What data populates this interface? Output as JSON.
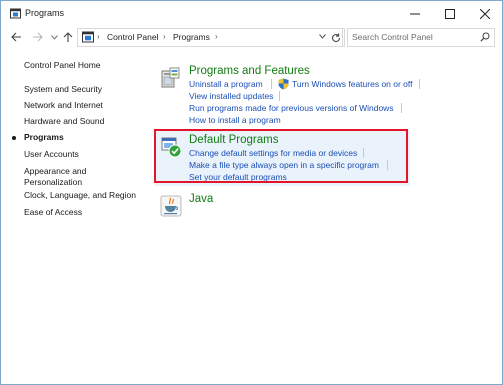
{
  "window": {
    "title": "Programs"
  },
  "address_bar": {
    "segments": [
      "Control Panel",
      "Programs"
    ],
    "search_placeholder": "Search Control Panel"
  },
  "sidebar": {
    "items": [
      {
        "label": "Control Panel Home",
        "current": false
      },
      {
        "label": "System and Security",
        "current": false
      },
      {
        "label": "Network and Internet",
        "current": false
      },
      {
        "label": "Hardware and Sound",
        "current": false
      },
      {
        "label": "Programs",
        "current": true
      },
      {
        "label": "User Accounts",
        "current": false
      },
      {
        "label": "Appearance and",
        "current": false
      },
      {
        "label": "Personalization",
        "current": false
      },
      {
        "label": "Clock, Language, and Region",
        "current": false
      },
      {
        "label": "Ease of Access",
        "current": false
      }
    ]
  },
  "categories": {
    "programs_features": {
      "title": "Programs and Features",
      "icon": "programs-features-icon",
      "links": [
        "Uninstall a program",
        "Turn Windows features on or off",
        "View installed updates",
        "Run programs made for previous versions of Windows",
        "How to install a program"
      ]
    },
    "default_programs": {
      "title": "Default Programs",
      "icon": "default-programs-icon",
      "links": [
        "Change default settings for media or devices",
        "Make a file type always open in a specific program",
        "Set your default programs"
      ]
    },
    "java": {
      "title": "Java",
      "icon": "java-icon"
    }
  },
  "colors": {
    "category_title": "#107c10",
    "link": "#1a4fb6",
    "highlight_border": "#e3152a",
    "highlight_fill": "#eaf2fb"
  }
}
